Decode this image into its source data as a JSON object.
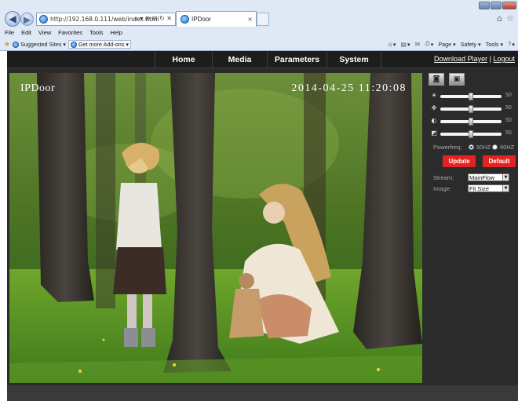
{
  "browser": {
    "url": "http://192.168.0.111/web/index.html",
    "address_tools": "⌕ ▾ ⊘ ⊟ ↻ ✕",
    "tab_title": "IPDoor",
    "tab_close": "×",
    "menu": [
      "File",
      "Edit",
      "View",
      "Favorites",
      "Tools",
      "Help"
    ],
    "favorites": {
      "suggested": "Suggested Sites ▾",
      "addons": "Get more Add-ons ▾"
    },
    "command_bar": {
      "home": "▾",
      "page": "Page ▾",
      "safety": "Safety ▾",
      "tools": "Tools ▾",
      "help": "▾"
    }
  },
  "nav": {
    "tabs": [
      "Home",
      "Media",
      "Parameters",
      "System"
    ],
    "download_player": "Download Player",
    "separator": "|",
    "logout": "Logout"
  },
  "video": {
    "osd_name": "IPDoor",
    "osd_time": "2014-04-25 11:20:08"
  },
  "panel": {
    "sliders": [
      {
        "icon": "brightness-icon",
        "glyph": "☀",
        "value": 50
      },
      {
        "icon": "contrast-icon",
        "glyph": "✥",
        "value": 50
      },
      {
        "icon": "saturation-icon",
        "glyph": "◐",
        "value": 50
      },
      {
        "icon": "sharpness-icon",
        "glyph": "◩",
        "value": 50
      }
    ],
    "powerfreq_label": "Powerfreq:",
    "powerfreq_options": [
      "50HZ",
      "60HZ"
    ],
    "powerfreq_selected": "50HZ",
    "update_label": "Update",
    "default_label": "Default",
    "stream_label": "Stream:",
    "stream_value": "MainFlow",
    "image_label": "Image:",
    "image_value": "Fit Size"
  },
  "colors": {
    "accent_red": "#e32222",
    "page_bg": "#2b2b2b",
    "nav_bg": "#1d1d1d"
  }
}
